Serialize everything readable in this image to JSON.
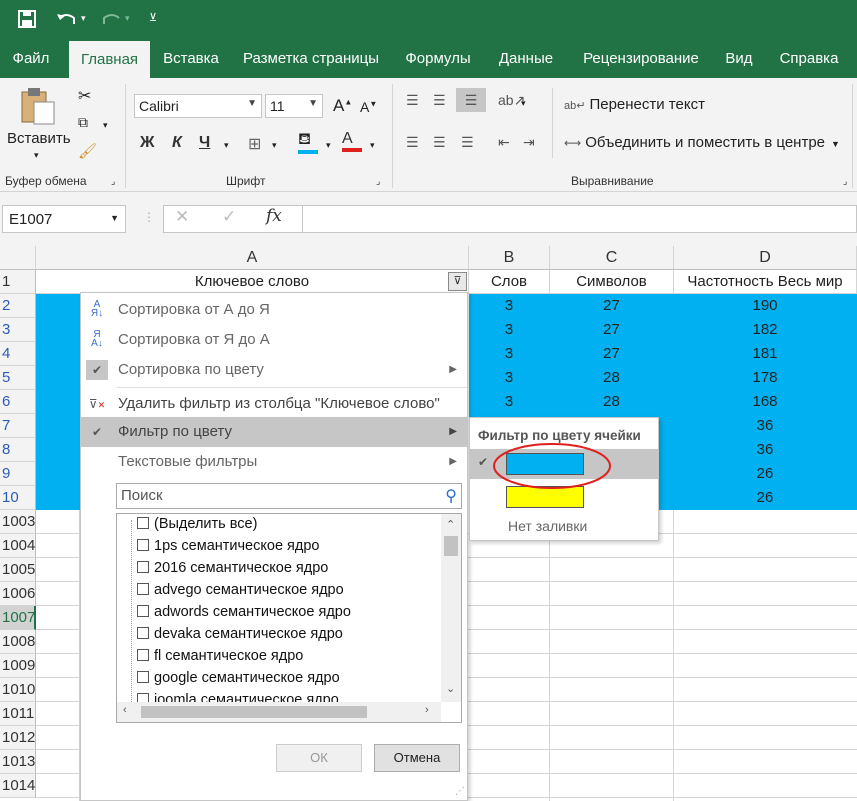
{
  "qat": {
    "save_icon": "save-icon",
    "undo_icon": "undo-icon",
    "redo_icon": "redo-icon",
    "customize_icon": "customize-icon"
  },
  "tabs": [
    {
      "label": "Файл"
    },
    {
      "label": "Главная"
    },
    {
      "label": "Вставка"
    },
    {
      "label": "Разметка страницы"
    },
    {
      "label": "Формулы"
    },
    {
      "label": "Данные"
    },
    {
      "label": "Рецензирование"
    },
    {
      "label": "Вид"
    },
    {
      "label": "Справка"
    }
  ],
  "ribbon": {
    "clipboard": {
      "paste_label": "Вставить",
      "group_label": "Буфер обмена"
    },
    "font": {
      "font_name": "Calibri",
      "font_size": "11",
      "bold": "Ж",
      "italic": "К",
      "underline": "Ч",
      "increase": "A",
      "decrease": "A",
      "font_color_letter": "A",
      "group_label": "Шрифт"
    },
    "alignment": {
      "wrap_text": "Перенести текст",
      "merge_center": "Объединить и поместить в центре",
      "group_label": "Выравнивание"
    }
  },
  "formula_bar": {
    "name_box": "E1007",
    "fx": "fx",
    "value": ""
  },
  "columns": [
    {
      "letter": "A"
    },
    {
      "letter": "B"
    },
    {
      "letter": "C"
    },
    {
      "letter": "D"
    }
  ],
  "header_row": {
    "a": "Ключевое слово",
    "b": "Слов",
    "c": "Символов",
    "d": "Частотность Весь мир"
  },
  "rows": [
    {
      "num": "1"
    },
    {
      "num": "2",
      "b": "3",
      "c": "27",
      "d": "190"
    },
    {
      "num": "3",
      "b": "3",
      "c": "27",
      "d": "182"
    },
    {
      "num": "4",
      "b": "3",
      "c": "27",
      "d": "181"
    },
    {
      "num": "5",
      "b": "3",
      "c": "28",
      "d": "178"
    },
    {
      "num": "6",
      "b": "3",
      "c": "28",
      "d": "168"
    },
    {
      "num": "7",
      "b": "",
      "c": "",
      "d": "36"
    },
    {
      "num": "8",
      "b": "",
      "c": "",
      "d": "36"
    },
    {
      "num": "9",
      "b": "",
      "c": "",
      "d": "26"
    },
    {
      "num": "10",
      "b": "",
      "c": "",
      "d": "26"
    },
    {
      "num": "1003"
    },
    {
      "num": "1004"
    },
    {
      "num": "1005"
    },
    {
      "num": "1006"
    },
    {
      "num": "1007"
    },
    {
      "num": "1008"
    },
    {
      "num": "1009"
    },
    {
      "num": "1010"
    },
    {
      "num": "1011"
    },
    {
      "num": "1012"
    },
    {
      "num": "1013"
    },
    {
      "num": "1014"
    }
  ],
  "filter_menu": {
    "sort_az": "Сортировка от А до Я",
    "sort_za": "Сортировка от Я до А",
    "sort_color": "Сортировка по цвету",
    "clear_filter": "Удалить фильтр из столбца \"Ключевое слово\"",
    "filter_color": "Фильтр по цвету",
    "text_filters": "Текстовые фильтры",
    "search_placeholder": "Поиск",
    "items": [
      "(Выделить все)",
      "1ps семантическое ядро",
      "2016 семантическое ядро",
      "advego семантическое ядро",
      "adwords семантическое ядро",
      "devaka семантическое ядро",
      "fl семантическое ядро",
      "google семантическое ядро",
      "joomla семантическое ядро"
    ],
    "ok": "ОК",
    "cancel": "Отмена"
  },
  "color_submenu": {
    "title": "Фильтр по цвету ячейки",
    "no_fill": "Нет заливки",
    "colors": [
      "#00b0f0",
      "#ffff00"
    ]
  },
  "colors": {
    "excel_green": "#217346",
    "highlight_blue": "#00b0f0",
    "yellow": "#ffff00",
    "annotation_red": "#e0201c"
  }
}
